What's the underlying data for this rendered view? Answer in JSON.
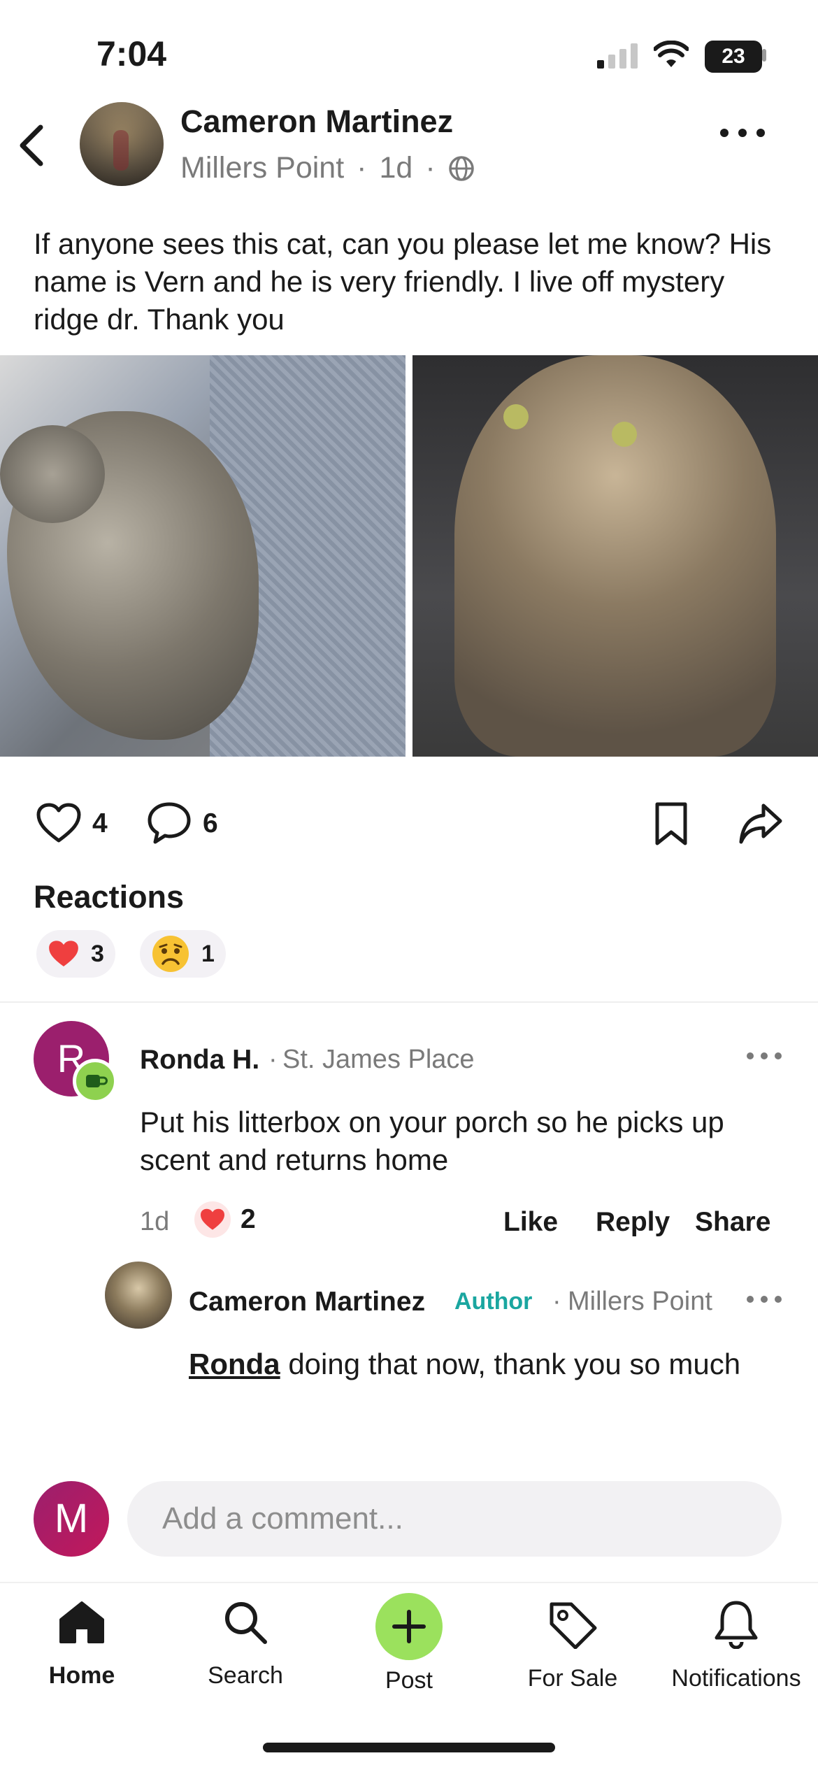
{
  "status_bar": {
    "time": "7:04",
    "battery": "23"
  },
  "post": {
    "author": "Cameron Martinez",
    "neighborhood": "Millers Point",
    "age": "1d",
    "text": "If anyone sees this cat, can you please let me know? His name is Vern and he is very friendly. I live off mystery ridge dr. Thank you",
    "likes": "4",
    "comments": "6"
  },
  "reactions": {
    "title": "Reactions",
    "items": [
      {
        "icon": "heart-reaction-icon",
        "count": "3"
      },
      {
        "icon": "sad-face-reaction-icon",
        "count": "1"
      }
    ]
  },
  "comments": [
    {
      "avatar_letter": "R",
      "name": "Ronda H.",
      "place": "St. James Place",
      "text": "Put his litterbox on your porch so he picks up scent and returns home",
      "age": "1d",
      "reaction_count": "2",
      "like_label": "Like",
      "reply_label": "Reply",
      "share_label": "Share"
    },
    {
      "name": "Cameron Martinez",
      "badge": "Author",
      "place": "Millers Point",
      "mention": "Ronda",
      "text": " doing that now, thank you so much"
    }
  ],
  "composer": {
    "avatar_letter": "M",
    "placeholder": "Add a comment..."
  },
  "tabs": [
    {
      "label": "Home",
      "icon": "home-icon"
    },
    {
      "label": "Search",
      "icon": "search-icon"
    },
    {
      "label": "Post",
      "icon": "plus-icon"
    },
    {
      "label": "For Sale",
      "icon": "tag-icon"
    },
    {
      "label": "Notifications",
      "icon": "bell-icon"
    }
  ],
  "colors": {
    "accent_green": "#9be15d",
    "author_badge": "#1aa6a0",
    "avatar_purple": "#9b1f6d"
  }
}
